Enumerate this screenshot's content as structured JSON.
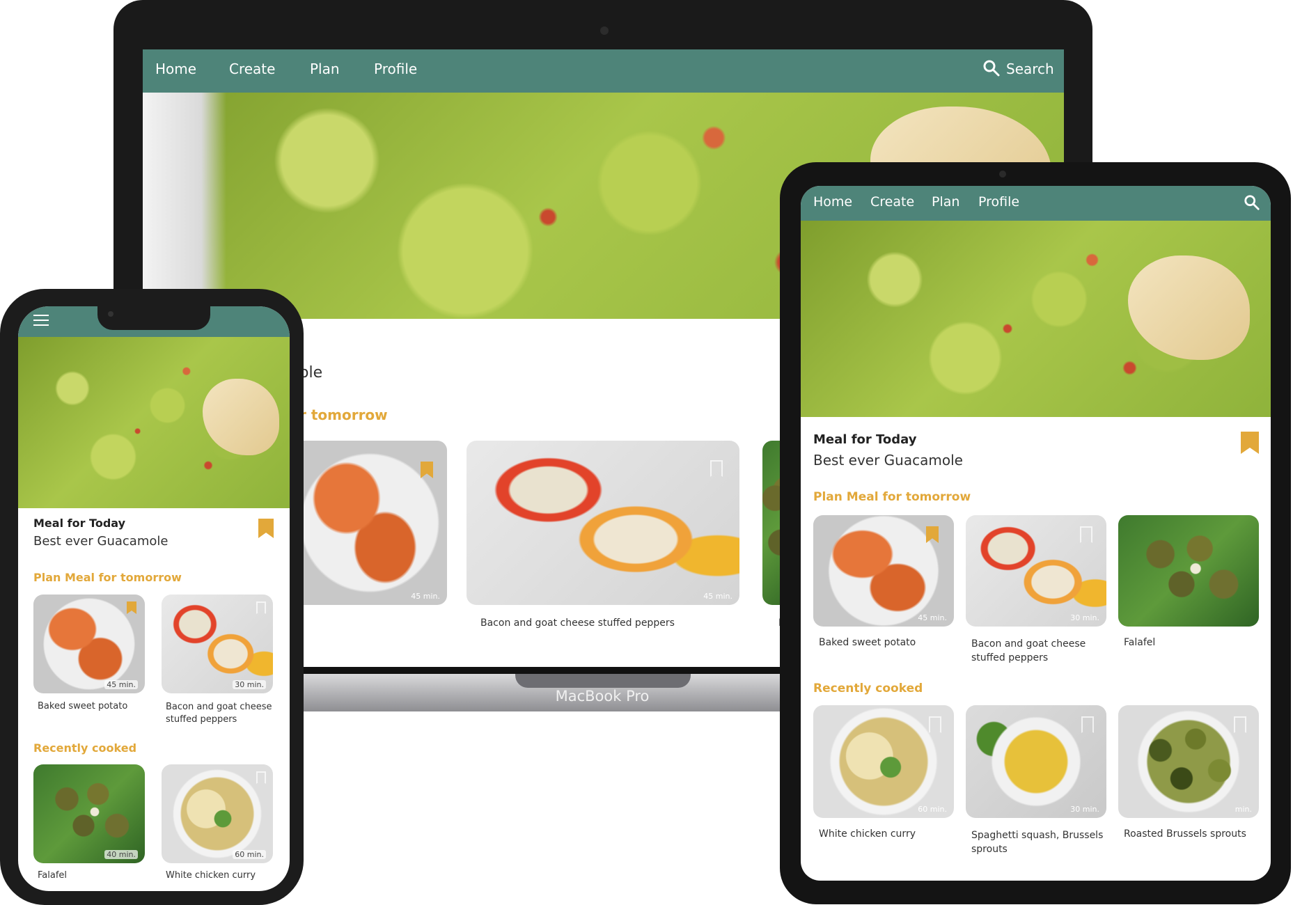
{
  "colors": {
    "nav": "#4e8479",
    "accent": "#e2a83a"
  },
  "laptop": {
    "nav": [
      "Home",
      "Create",
      "Plan",
      "Profile"
    ],
    "search": "Search",
    "title_partial": "ole",
    "section_partial": "r tomorrow",
    "cards": [
      {
        "time": "45 min.",
        "title": ""
      },
      {
        "time": "45 min.",
        "title": "Bacon and goat cheese stuffed peppers"
      }
    ],
    "cut_letter": "F",
    "brand": "MacBook Pro"
  },
  "tablet": {
    "nav": [
      "Home",
      "Create",
      "Plan",
      "Profile"
    ],
    "meal_label": "Meal for Today",
    "meal_title": "Best ever Guacamole",
    "plan_heading": "Plan Meal for tomorrow",
    "plan_cards": [
      {
        "time": "45 min.",
        "title": "Baked sweet potato"
      },
      {
        "time": "30 min.",
        "title": "Bacon and goat cheese stuffed peppers"
      },
      {
        "time": "",
        "title": "Falafel"
      }
    ],
    "recent_heading": "Recently cooked",
    "recent_cards": [
      {
        "time": "60 min.",
        "title": "White chicken curry"
      },
      {
        "time": "30 min.",
        "title": "Spaghetti squash, Brussels sprouts"
      },
      {
        "time": "min.",
        "title": "Roasted Brussels sprouts"
      }
    ]
  },
  "phone": {
    "meal_label": "Meal for Today",
    "meal_title": "Best ever Guacamole",
    "plan_heading": "Plan Meal for tomorrow",
    "plan_cards": [
      {
        "time": "45 min.",
        "title": "Baked sweet potato"
      },
      {
        "time": "30 min.",
        "title": "Bacon and goat cheese stuffed peppers"
      }
    ],
    "recent_heading": "Recently cooked",
    "recent_cards": [
      {
        "time": "40 min.",
        "title": "Falafel"
      },
      {
        "time": "60 min.",
        "title": "White chicken curry"
      }
    ]
  }
}
